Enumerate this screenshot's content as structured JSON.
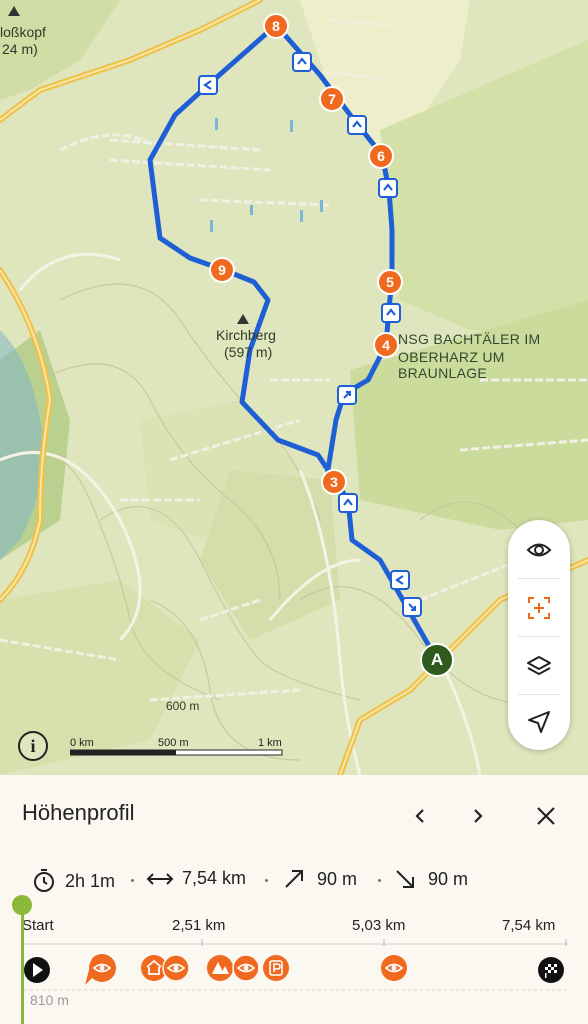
{
  "map": {
    "place_labels": [
      {
        "id": "schlosskopf",
        "text": "loßkopf"
      },
      {
        "id": "schlosskopf-elev",
        "text": "24 m)"
      },
      {
        "id": "kirchberg",
        "text": "Kirchberg"
      },
      {
        "id": "kirchberg-elev",
        "text": "(597 m)"
      },
      {
        "id": "nsg-line1",
        "text": "NSG BACHTÄLER IM"
      },
      {
        "id": "nsg-line2",
        "text": "OBERHARZ UM BRAUNLAGE"
      },
      {
        "id": "contour-600",
        "text": "600 m"
      }
    ],
    "waypoints": [
      "3",
      "4",
      "5",
      "6",
      "7",
      "8",
      "9"
    ],
    "start_marker": "A",
    "scale": {
      "zero": "0 km",
      "mid": "500 m",
      "end": "1 km"
    },
    "controls": [
      "eye-icon",
      "focus-icon",
      "layers-icon",
      "locate-icon"
    ],
    "info_label": "i",
    "colors": {
      "route": "#1f5fd6",
      "waypoint": "#ef6a1f",
      "start": "#2f5a1b",
      "road": "#f3c44a"
    }
  },
  "panel": {
    "title": "Höhenprofil",
    "stats": {
      "duration": "2h 1m",
      "distance": "7,54 km",
      "ascent": "90 m",
      "descent": "90 m"
    },
    "axis": {
      "start": "Start",
      "km1": "2,51 km",
      "km2": "5,03 km",
      "km3": "7,54 km"
    },
    "elevation_label": "810 m",
    "poi_icons": [
      "start-flag",
      "viewpoint",
      "hut",
      "viewpoint",
      "camp",
      "viewpoint",
      "parking",
      "viewpoint",
      "finish-flag"
    ]
  }
}
